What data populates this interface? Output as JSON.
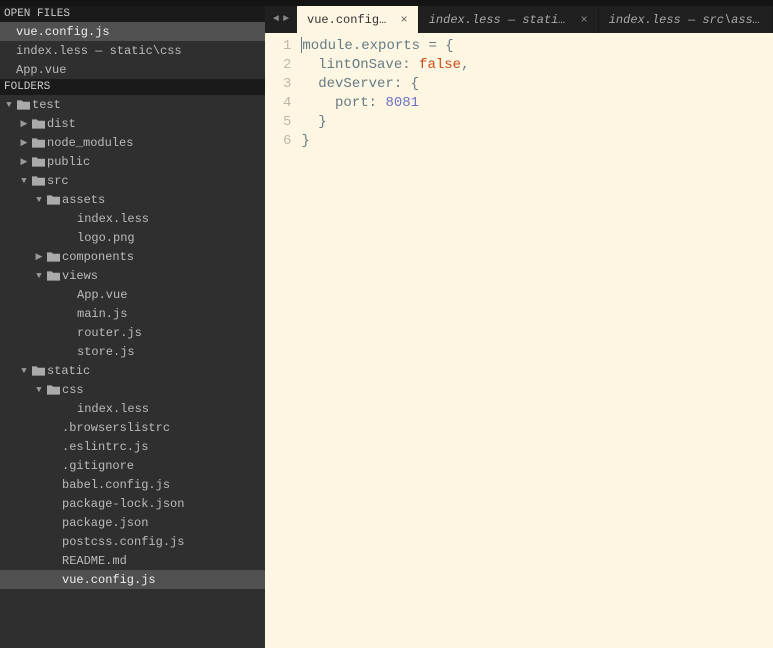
{
  "sections": {
    "open_files_title": "OPEN FILES",
    "folders_title": "FOLDERS"
  },
  "open_files": [
    {
      "name": "vue.config.js",
      "active": true
    },
    {
      "name": "index.less — static\\css",
      "active": false
    },
    {
      "name": "App.vue",
      "active": false
    }
  ],
  "root_folder": "test",
  "tree": [
    {
      "depth": 0,
      "arrow": "down",
      "kind": "folder",
      "name": "test"
    },
    {
      "depth": 1,
      "arrow": "right",
      "kind": "folder",
      "name": "dist"
    },
    {
      "depth": 1,
      "arrow": "right",
      "kind": "folder",
      "name": "node_modules"
    },
    {
      "depth": 1,
      "arrow": "right",
      "kind": "folder",
      "name": "public"
    },
    {
      "depth": 1,
      "arrow": "down",
      "kind": "folder",
      "name": "src"
    },
    {
      "depth": 2,
      "arrow": "down",
      "kind": "folder",
      "name": "assets"
    },
    {
      "depth": 3,
      "arrow": "",
      "kind": "file",
      "name": "index.less"
    },
    {
      "depth": 3,
      "arrow": "",
      "kind": "file",
      "name": "logo.png"
    },
    {
      "depth": 2,
      "arrow": "right",
      "kind": "folder",
      "name": "components"
    },
    {
      "depth": 2,
      "arrow": "down",
      "kind": "folder",
      "name": "views"
    },
    {
      "depth": 3,
      "arrow": "",
      "kind": "file",
      "name": "App.vue"
    },
    {
      "depth": 3,
      "arrow": "",
      "kind": "file",
      "name": "main.js"
    },
    {
      "depth": 3,
      "arrow": "",
      "kind": "file",
      "name": "router.js"
    },
    {
      "depth": 3,
      "arrow": "",
      "kind": "file",
      "name": "store.js"
    },
    {
      "depth": 1,
      "arrow": "down",
      "kind": "folder",
      "name": "static"
    },
    {
      "depth": 2,
      "arrow": "down",
      "kind": "folder",
      "name": "css"
    },
    {
      "depth": 3,
      "arrow": "",
      "kind": "file",
      "name": "index.less"
    },
    {
      "depth": 2,
      "arrow": "",
      "kind": "file",
      "name": ".browserslistrc"
    },
    {
      "depth": 2,
      "arrow": "",
      "kind": "file",
      "name": ".eslintrc.js"
    },
    {
      "depth": 2,
      "arrow": "",
      "kind": "file",
      "name": ".gitignore"
    },
    {
      "depth": 2,
      "arrow": "",
      "kind": "file",
      "name": "babel.config.js"
    },
    {
      "depth": 2,
      "arrow": "",
      "kind": "file",
      "name": "package-lock.json"
    },
    {
      "depth": 2,
      "arrow": "",
      "kind": "file",
      "name": "package.json"
    },
    {
      "depth": 2,
      "arrow": "",
      "kind": "file",
      "name": "postcss.config.js"
    },
    {
      "depth": 2,
      "arrow": "",
      "kind": "file",
      "name": "README.md"
    },
    {
      "depth": 2,
      "arrow": "",
      "kind": "file",
      "name": "vue.config.js",
      "active": true
    }
  ],
  "tabs": [
    {
      "label": "vue.config.js",
      "active": true,
      "closable": true
    },
    {
      "label": "index.less — static\\css",
      "active": false,
      "closable": true
    },
    {
      "label": "index.less — src\\assets",
      "active": false,
      "closable": false
    }
  ],
  "nav": {
    "back": "◄",
    "fwd": "►"
  },
  "code_lines": [
    {
      "n": "1",
      "t": [
        "module",
        ".",
        "exports",
        " ",
        "=",
        " ",
        "{"
      ],
      "cls": [
        "k-var",
        "k-op",
        "k-var",
        "",
        "k-op",
        "",
        "k-punc"
      ]
    },
    {
      "n": "2",
      "t": [
        "  ",
        "lintOnSave",
        ":",
        " ",
        "false",
        ","
      ],
      "cls": [
        "",
        "k-var",
        "k-punc",
        "",
        "k-false",
        "k-punc"
      ]
    },
    {
      "n": "3",
      "t": [
        "  ",
        "devServer",
        ":",
        " ",
        "{"
      ],
      "cls": [
        "",
        "k-var",
        "k-punc",
        "",
        "k-punc"
      ]
    },
    {
      "n": "4",
      "t": [
        "    ",
        "port",
        ":",
        " ",
        "8081"
      ],
      "cls": [
        "",
        "k-var",
        "k-punc",
        "",
        "k-num"
      ]
    },
    {
      "n": "5",
      "t": [
        "  ",
        "}"
      ],
      "cls": [
        "",
        "k-punc"
      ]
    },
    {
      "n": "6",
      "t": [
        "}"
      ],
      "cls": [
        "k-punc"
      ]
    }
  ]
}
